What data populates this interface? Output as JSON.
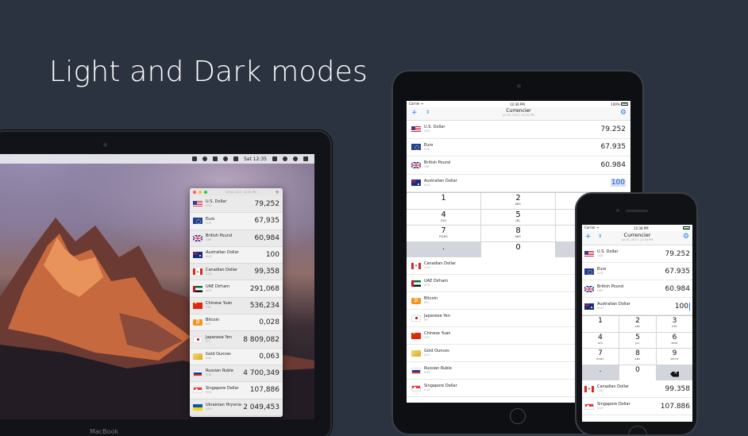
{
  "headline": "Light and Dark modes",
  "mac": {
    "brand_label": "MacBook",
    "menubar_time": "Sat 12:35",
    "panel": {
      "timestamp": "20 Jul 2017, 12:34 PM",
      "add_label": "+",
      "rows": [
        {
          "name": "U.S. Dollar",
          "code": "USD",
          "value": "79,252",
          "flag": "us"
        },
        {
          "name": "Euro",
          "code": "EUR",
          "value": "67,935",
          "flag": "eu"
        },
        {
          "name": "British Pound",
          "code": "GBP",
          "value": "60,984",
          "flag": "gb"
        },
        {
          "name": "Australian Dollar",
          "code": "AUD",
          "value": "100",
          "flag": "au"
        },
        {
          "name": "Canadian Dollar",
          "code": "CAD",
          "value": "99,358",
          "flag": "ca"
        },
        {
          "name": "UAE Dirham",
          "code": "AED",
          "value": "291,068",
          "flag": "ae"
        },
        {
          "name": "Chinese Yuan",
          "code": "CNY",
          "value": "536,234",
          "flag": "cn"
        },
        {
          "name": "Bitcoin",
          "code": "BTC",
          "value": "0,028",
          "flag": "btc"
        },
        {
          "name": "Japanese Yen",
          "code": "JPY",
          "value": "8 809,082",
          "flag": "jp"
        },
        {
          "name": "Gold Ounces",
          "code": "XAU",
          "value": "0,063",
          "flag": "xau"
        },
        {
          "name": "Russian Ruble",
          "code": "RUB",
          "value": "4 700,349",
          "flag": "ru"
        },
        {
          "name": "Singapore Dollar",
          "code": "SGD",
          "value": "107,886",
          "flag": "sg"
        },
        {
          "name": "Ukrainian Hryvnia",
          "code": "UAH",
          "value": "2 049,453",
          "flag": "ua"
        }
      ]
    }
  },
  "ipad": {
    "status": {
      "carrier": "Carrier ᯤ",
      "time": "12:36 PM",
      "battery": "100%"
    },
    "nav": {
      "title": "Currencier",
      "subtitle": "Jul 20, 2017, 12:34 PM",
      "add_label": "+",
      "sort_label": "⇕",
      "settings_label": "⚙"
    },
    "top_rows": [
      {
        "name": "U.S. Dollar",
        "code": "USD",
        "value": "79.252",
        "flag": "us"
      },
      {
        "name": "Euro",
        "code": "EUR",
        "value": "67.935",
        "flag": "eu"
      },
      {
        "name": "British Pound",
        "code": "GBP",
        "value": "60.984",
        "flag": "gb"
      },
      {
        "name": "Australian Dollar",
        "code": "AUD",
        "value": "100",
        "flag": "au",
        "active": true
      }
    ],
    "keypad": [
      {
        "digit": "1",
        "letters": ""
      },
      {
        "digit": "2",
        "letters": "ABC"
      },
      {
        "digit": "",
        "letters": ""
      },
      {
        "digit": "4",
        "letters": "GHI"
      },
      {
        "digit": "5",
        "letters": "JKL"
      },
      {
        "digit": "",
        "letters": ""
      },
      {
        "digit": "7",
        "letters": "PQRS"
      },
      {
        "digit": "8",
        "letters": "ABC"
      },
      {
        "digit": "",
        "letters": ""
      },
      {
        "digit": ".",
        "letters": "",
        "gray": true
      },
      {
        "digit": "0",
        "letters": ""
      },
      {
        "digit": "",
        "letters": "",
        "gray": true
      }
    ],
    "bottom_rows": [
      {
        "name": "Canadian Dollar",
        "code": "CAD",
        "flag": "ca"
      },
      {
        "name": "UAE Dirham",
        "code": "AED",
        "flag": "ae"
      },
      {
        "name": "Bitcoin",
        "code": "BTC",
        "flag": "btc"
      },
      {
        "name": "Japanese Yen",
        "code": "JPY",
        "flag": "jp"
      },
      {
        "name": "Chinese Yuan",
        "code": "CNY",
        "flag": "cn"
      },
      {
        "name": "Gold Ounces",
        "code": "XAU",
        "flag": "xau"
      },
      {
        "name": "Russian Ruble",
        "code": "RUB",
        "flag": "ru"
      },
      {
        "name": "Singapore Dollar",
        "code": "SGD",
        "flag": "sg"
      }
    ]
  },
  "iphone": {
    "status": {
      "carrier": "Carrier ᯤ",
      "time": "12:38 PM",
      "battery": ""
    },
    "nav": {
      "title": "Currencier",
      "subtitle": "Jul 20, 2017, 12:34 PM",
      "add_label": "+",
      "sort_label": "⇕",
      "settings_label": "⚙"
    },
    "top_rows": [
      {
        "name": "U.S. Dollar",
        "code": "USD",
        "value": "79.252",
        "flag": "us"
      },
      {
        "name": "Euro",
        "code": "EUR",
        "value": "67.935",
        "flag": "eu"
      },
      {
        "name": "British Pound",
        "code": "GBP",
        "value": "60.984",
        "flag": "gb"
      },
      {
        "name": "Australian Dollar",
        "code": "AUD",
        "value": "100",
        "flag": "au",
        "active": true
      }
    ],
    "keypad": [
      {
        "digit": "1",
        "letters": ""
      },
      {
        "digit": "2",
        "letters": "ABC"
      },
      {
        "digit": "3",
        "letters": "DEF"
      },
      {
        "digit": "4",
        "letters": "GHI"
      },
      {
        "digit": "5",
        "letters": "JKL"
      },
      {
        "digit": "6",
        "letters": "MNO"
      },
      {
        "digit": "7",
        "letters": "PQRS"
      },
      {
        "digit": "8",
        "letters": "ABC"
      },
      {
        "digit": "9",
        "letters": "WXYZ"
      },
      {
        "digit": ".",
        "letters": "",
        "gray": true
      },
      {
        "digit": "0",
        "letters": ""
      },
      {
        "digit": "",
        "letters": "",
        "gray": true,
        "backspace": true
      }
    ],
    "bottom_rows": [
      {
        "name": "Canadian Dollar",
        "code": "CAD",
        "value": "99.358",
        "flag": "ca"
      },
      {
        "name": "Singapore Dollar",
        "code": "SGD",
        "value": "107.886",
        "flag": "sg"
      }
    ]
  }
}
